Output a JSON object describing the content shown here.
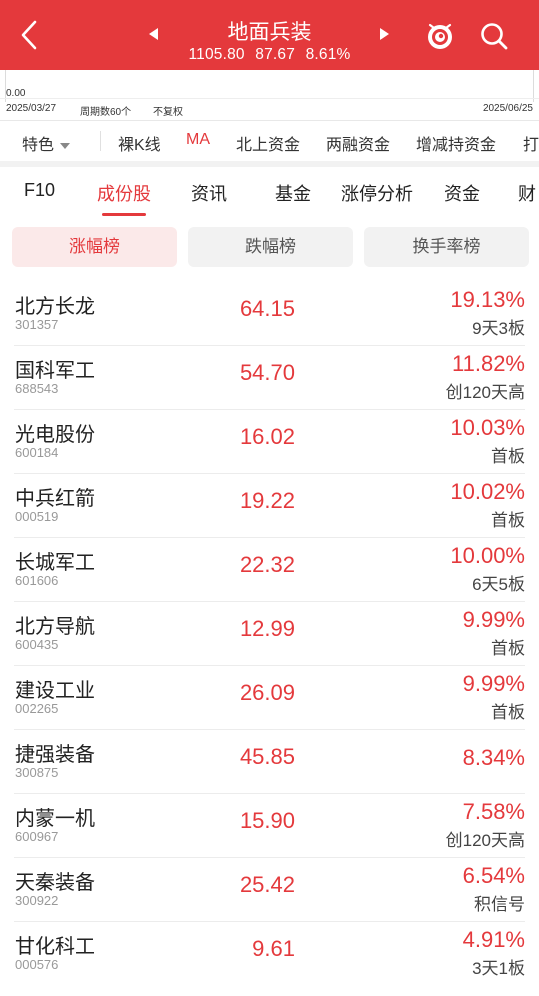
{
  "header": {
    "title": "地面兵装",
    "index_value": "1105.80",
    "change": "87.67",
    "change_pct": "8.61%",
    "bg_color": "#e4393c"
  },
  "chart_strip": {
    "zero_label": "0.00",
    "start_date": "2025/03/27",
    "period_label": "周期数60个",
    "adjust_label": "不复权",
    "end_date": "2025/06/25"
  },
  "indicator_tabs": [
    {
      "label": "特色",
      "has_caret": true
    },
    {
      "label": "裸K线"
    },
    {
      "label": "MA",
      "active": true
    },
    {
      "label": "北上资金"
    },
    {
      "label": "两融资金"
    },
    {
      "label": "增减持资金"
    },
    {
      "label": "打"
    }
  ],
  "main_tabs": [
    {
      "label": "F10"
    },
    {
      "label": "成份股",
      "active": true
    },
    {
      "label": "资讯"
    },
    {
      "label": "基金"
    },
    {
      "label": "涨停分析"
    },
    {
      "label": "资金"
    },
    {
      "label": "财"
    }
  ],
  "sub_tabs": [
    {
      "label": "涨幅榜",
      "active": true
    },
    {
      "label": "跌幅榜"
    },
    {
      "label": "换手率榜"
    }
  ],
  "stocks": [
    {
      "name": "北方长龙",
      "code": "301357",
      "price": "64.15",
      "pct": "19.13%",
      "tag": "9天3板"
    },
    {
      "name": "国科军工",
      "code": "688543",
      "price": "54.70",
      "pct": "11.82%",
      "tag": "创120天高"
    },
    {
      "name": "光电股份",
      "code": "600184",
      "price": "16.02",
      "pct": "10.03%",
      "tag": "首板"
    },
    {
      "name": "中兵红箭",
      "code": "000519",
      "price": "19.22",
      "pct": "10.02%",
      "tag": "首板"
    },
    {
      "name": "长城军工",
      "code": "601606",
      "price": "22.32",
      "pct": "10.00%",
      "tag": "6天5板"
    },
    {
      "name": "北方导航",
      "code": "600435",
      "price": "12.99",
      "pct": "9.99%",
      "tag": "首板"
    },
    {
      "name": "建设工业",
      "code": "002265",
      "price": "26.09",
      "pct": "9.99%",
      "tag": "首板"
    },
    {
      "name": "捷强装备",
      "code": "300875",
      "price": "45.85",
      "pct": "8.34%",
      "tag": ""
    },
    {
      "name": "内蒙一机",
      "code": "600967",
      "price": "15.90",
      "pct": "7.58%",
      "tag": "创120天高"
    },
    {
      "name": "天秦装备",
      "code": "300922",
      "price": "25.42",
      "pct": "6.54%",
      "tag": "积信号"
    },
    {
      "name": "甘化科工",
      "code": "000576",
      "price": "9.61",
      "pct": "4.91%",
      "tag": "3天1板"
    }
  ],
  "icons": {
    "back": "chevron-left-icon",
    "prev": "triangle-left-icon",
    "next": "triangle-right-icon",
    "assistant": "robot-icon",
    "search": "search-icon",
    "dropdown": "caret-down-icon"
  },
  "colors": {
    "accent": "#e4393c",
    "up": "#e4393c",
    "active_tab_bg": "#fbe9e9"
  }
}
